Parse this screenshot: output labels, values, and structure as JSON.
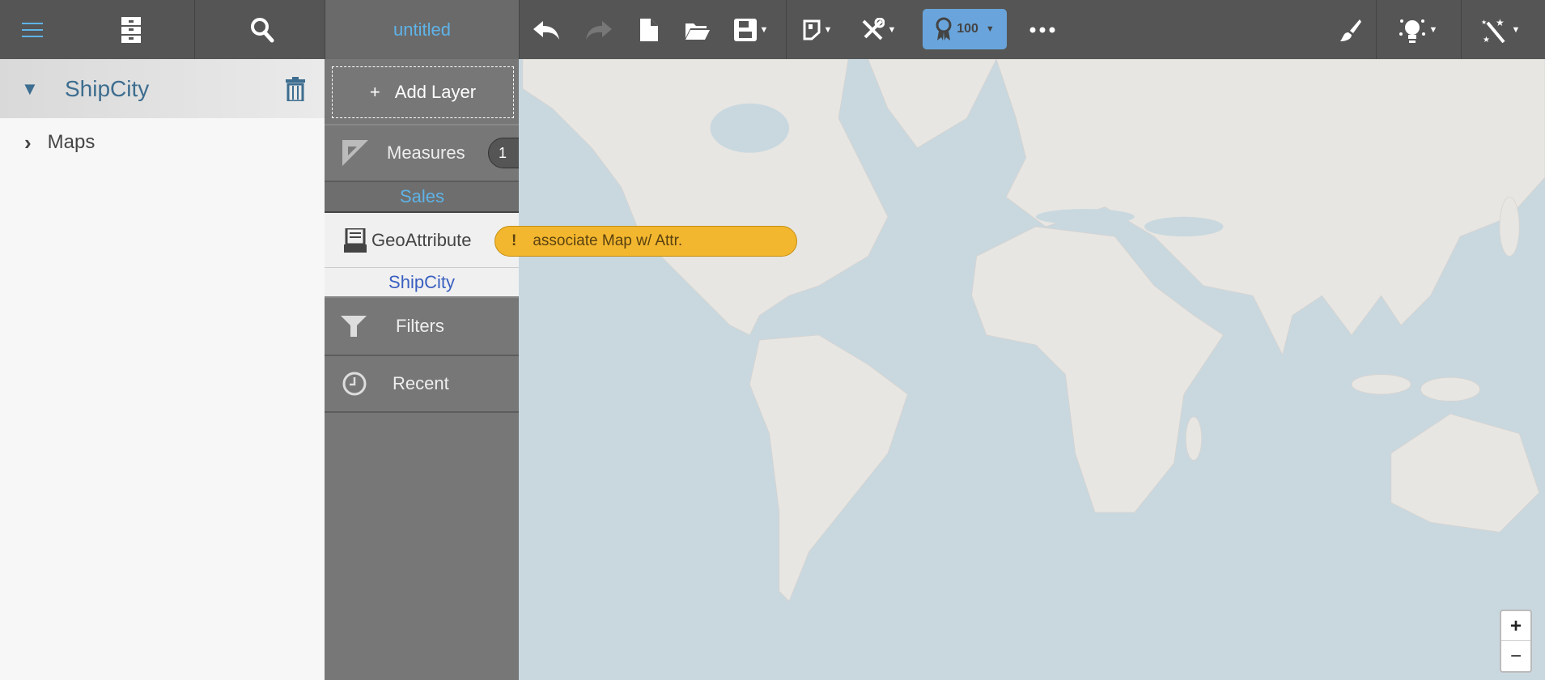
{
  "toolbar": {
    "title": "untitled",
    "badge_value": "100",
    "icons": [
      "hamburger-menu-icon",
      "file-cabinet-icon",
      "search-icon",
      "undo-icon",
      "redo-icon",
      "new-file-icon",
      "open-folder-icon",
      "save-icon",
      "map-chart-icon",
      "tools-icon",
      "award-icon",
      "more-icon",
      "brush-icon",
      "lightbulb-icon",
      "magic-wand-icon"
    ]
  },
  "left": {
    "layer_name": "ShipCity",
    "tree": [
      {
        "label": "Maps"
      }
    ]
  },
  "mid": {
    "add_layer": "Add Layer",
    "add_icon": "+",
    "measures": "Measures",
    "measures_count": "1",
    "measure_item": "Sales",
    "geo": "GeoAttribute",
    "geo_item": "ShipCity",
    "filters": "Filters",
    "recent": "Recent"
  },
  "warning": {
    "icon": "!",
    "text": "associate Map w/ Attr."
  },
  "zoom": {
    "in": "+",
    "out": "−"
  },
  "colors": {
    "accent": "#5fb3e8",
    "badge": "#69a5dc",
    "warning": "#f3b72f",
    "layer_text": "#3d6d8f"
  }
}
